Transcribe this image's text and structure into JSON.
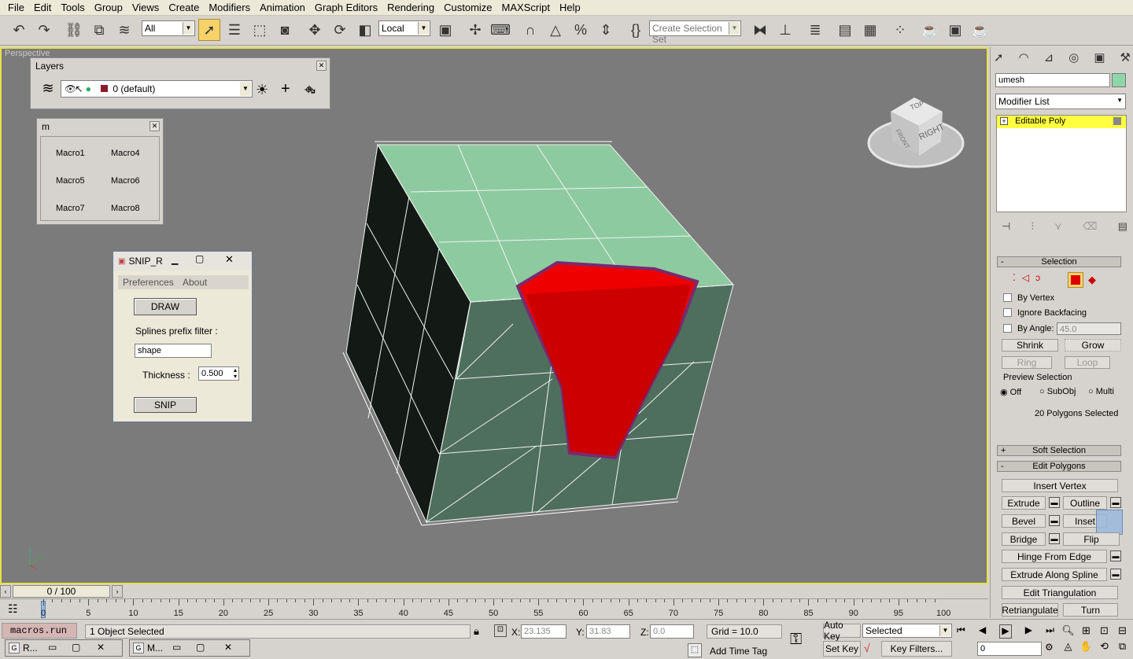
{
  "menu": [
    "File",
    "Edit",
    "Tools",
    "Group",
    "Views",
    "Create",
    "Modifiers",
    "Animation",
    "Graph Editors",
    "Rendering",
    "Customize",
    "MAXScript",
    "Help"
  ],
  "toolbar": {
    "filter": "All",
    "coord": "Local",
    "selection_set_placeholder": "Create Selection Set"
  },
  "viewport": {
    "label": "Perspective",
    "viewcube_top": "TOP",
    "viewcube_right": "RIGHT",
    "viewcube_front": "FRONT"
  },
  "layers": {
    "title": "Layers",
    "current": "0 (default)"
  },
  "macros": {
    "title": "m",
    "items": [
      "Macro1",
      "Macro4",
      "Macro5",
      "Macro6",
      "Macro7",
      "Macro8"
    ]
  },
  "snip": {
    "title": "SNIP_R",
    "menu_preferences": "Preferences",
    "menu_about": "About",
    "draw": "DRAW",
    "prefix_label": "Splines prefix filter :",
    "prefix_value": "shape",
    "thickness_label": "Thickness :",
    "thickness_value": "0.500",
    "snip": "SNIP"
  },
  "command": {
    "object_name": "umesh",
    "object_color": "#8ed6a8",
    "modifier_list": "Modifier List",
    "stack_item": "Editable Poly",
    "selection_title": "Selection",
    "by_vertex": "By Vertex",
    "ignore_backfacing": "Ignore Backfacing",
    "by_angle": "By Angle:",
    "angle_value": "45.0",
    "shrink": "Shrink",
    "grow": "Grow",
    "ring": "Ring",
    "loop": "Loop",
    "preview_title": "Preview Selection",
    "preview_off": "Off",
    "preview_subobj": "SubObj",
    "preview_multi": "Multi",
    "selected_count": "20 Polygons Selected",
    "soft_selection": "Soft Selection",
    "edit_polygons": "Edit Polygons",
    "insert_vertex": "Insert Vertex",
    "extrude": "Extrude",
    "outline": "Outline",
    "bevel": "Bevel",
    "inset": "Inset",
    "bridge": "Bridge",
    "flip": "Flip",
    "hinge": "Hinge From Edge",
    "extrude_spline": "Extrude Along Spline",
    "edit_tri": "Edit Triangulation",
    "retriangulate": "Retriangulate",
    "turn": "Turn"
  },
  "timeline": {
    "frame": "0 / 100",
    "ticks": [
      "0",
      "5",
      "10",
      "15",
      "20",
      "25",
      "30",
      "35",
      "40",
      "45",
      "50",
      "55",
      "60",
      "65",
      "70",
      "75",
      "80",
      "85",
      "90",
      "95",
      "100"
    ]
  },
  "status": {
    "script": "macros.run",
    "objects": "1 Object Selected",
    "x_label": "X:",
    "x_value": "23.135",
    "y_label": "Y:",
    "y_value": "31.83",
    "z_label": "Z:",
    "z_value": "0.0",
    "grid": "Grid = 10.0",
    "auto_key": "Auto Key",
    "set_key": "Set Key",
    "key_mode": "Selected",
    "key_filters": "Key Filters...",
    "add_time_tag": "Add Time Tag",
    "frame_value": "0",
    "task1": "R...",
    "task2": "M..."
  }
}
